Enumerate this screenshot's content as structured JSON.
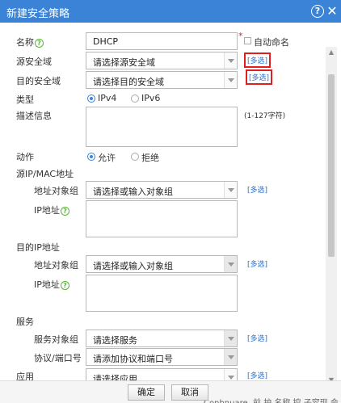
{
  "title": "新建安全策略",
  "fields": {
    "name_label": "名称",
    "name_value": "DHCP",
    "auto_name_label": "自动命名",
    "src_zone_label": "源安全域",
    "src_zone_placeholder": "请选择源安全域",
    "dst_zone_label": "目的安全域",
    "dst_zone_placeholder": "请选择目的安全域",
    "type_label": "类型",
    "type_ipv4": "IPv4",
    "type_ipv6": "IPv6",
    "desc_label": "描述信息",
    "desc_hint": "(1-127字符)",
    "action_label": "动作",
    "action_allow": "允许",
    "action_deny": "拒绝",
    "src_section": "源IP/MAC地址",
    "src_addr_obj_label": "地址对象组",
    "src_addr_obj_placeholder": "请选择或输入对象组",
    "src_ip_label": "IP地址",
    "dst_section": "目的IP地址",
    "dst_addr_obj_label": "地址对象组",
    "dst_addr_obj_placeholder": "请选择或输入对象组",
    "dst_ip_label": "IP地址",
    "service_section": "服务",
    "service_obj_label": "服务对象组",
    "service_obj_placeholder": "请选择服务",
    "proto_port_label": "协议/端口号",
    "proto_port_placeholder": "请添加协议和端口号",
    "app_section": "应用",
    "app_placeholder": "请选择应用"
  },
  "multi_label": "[多选]",
  "buttons": {
    "ok": "确定",
    "cancel": "取消"
  },
  "background_text": "Conhnuare. 前 护 名称  控 子容现 会 方"
}
